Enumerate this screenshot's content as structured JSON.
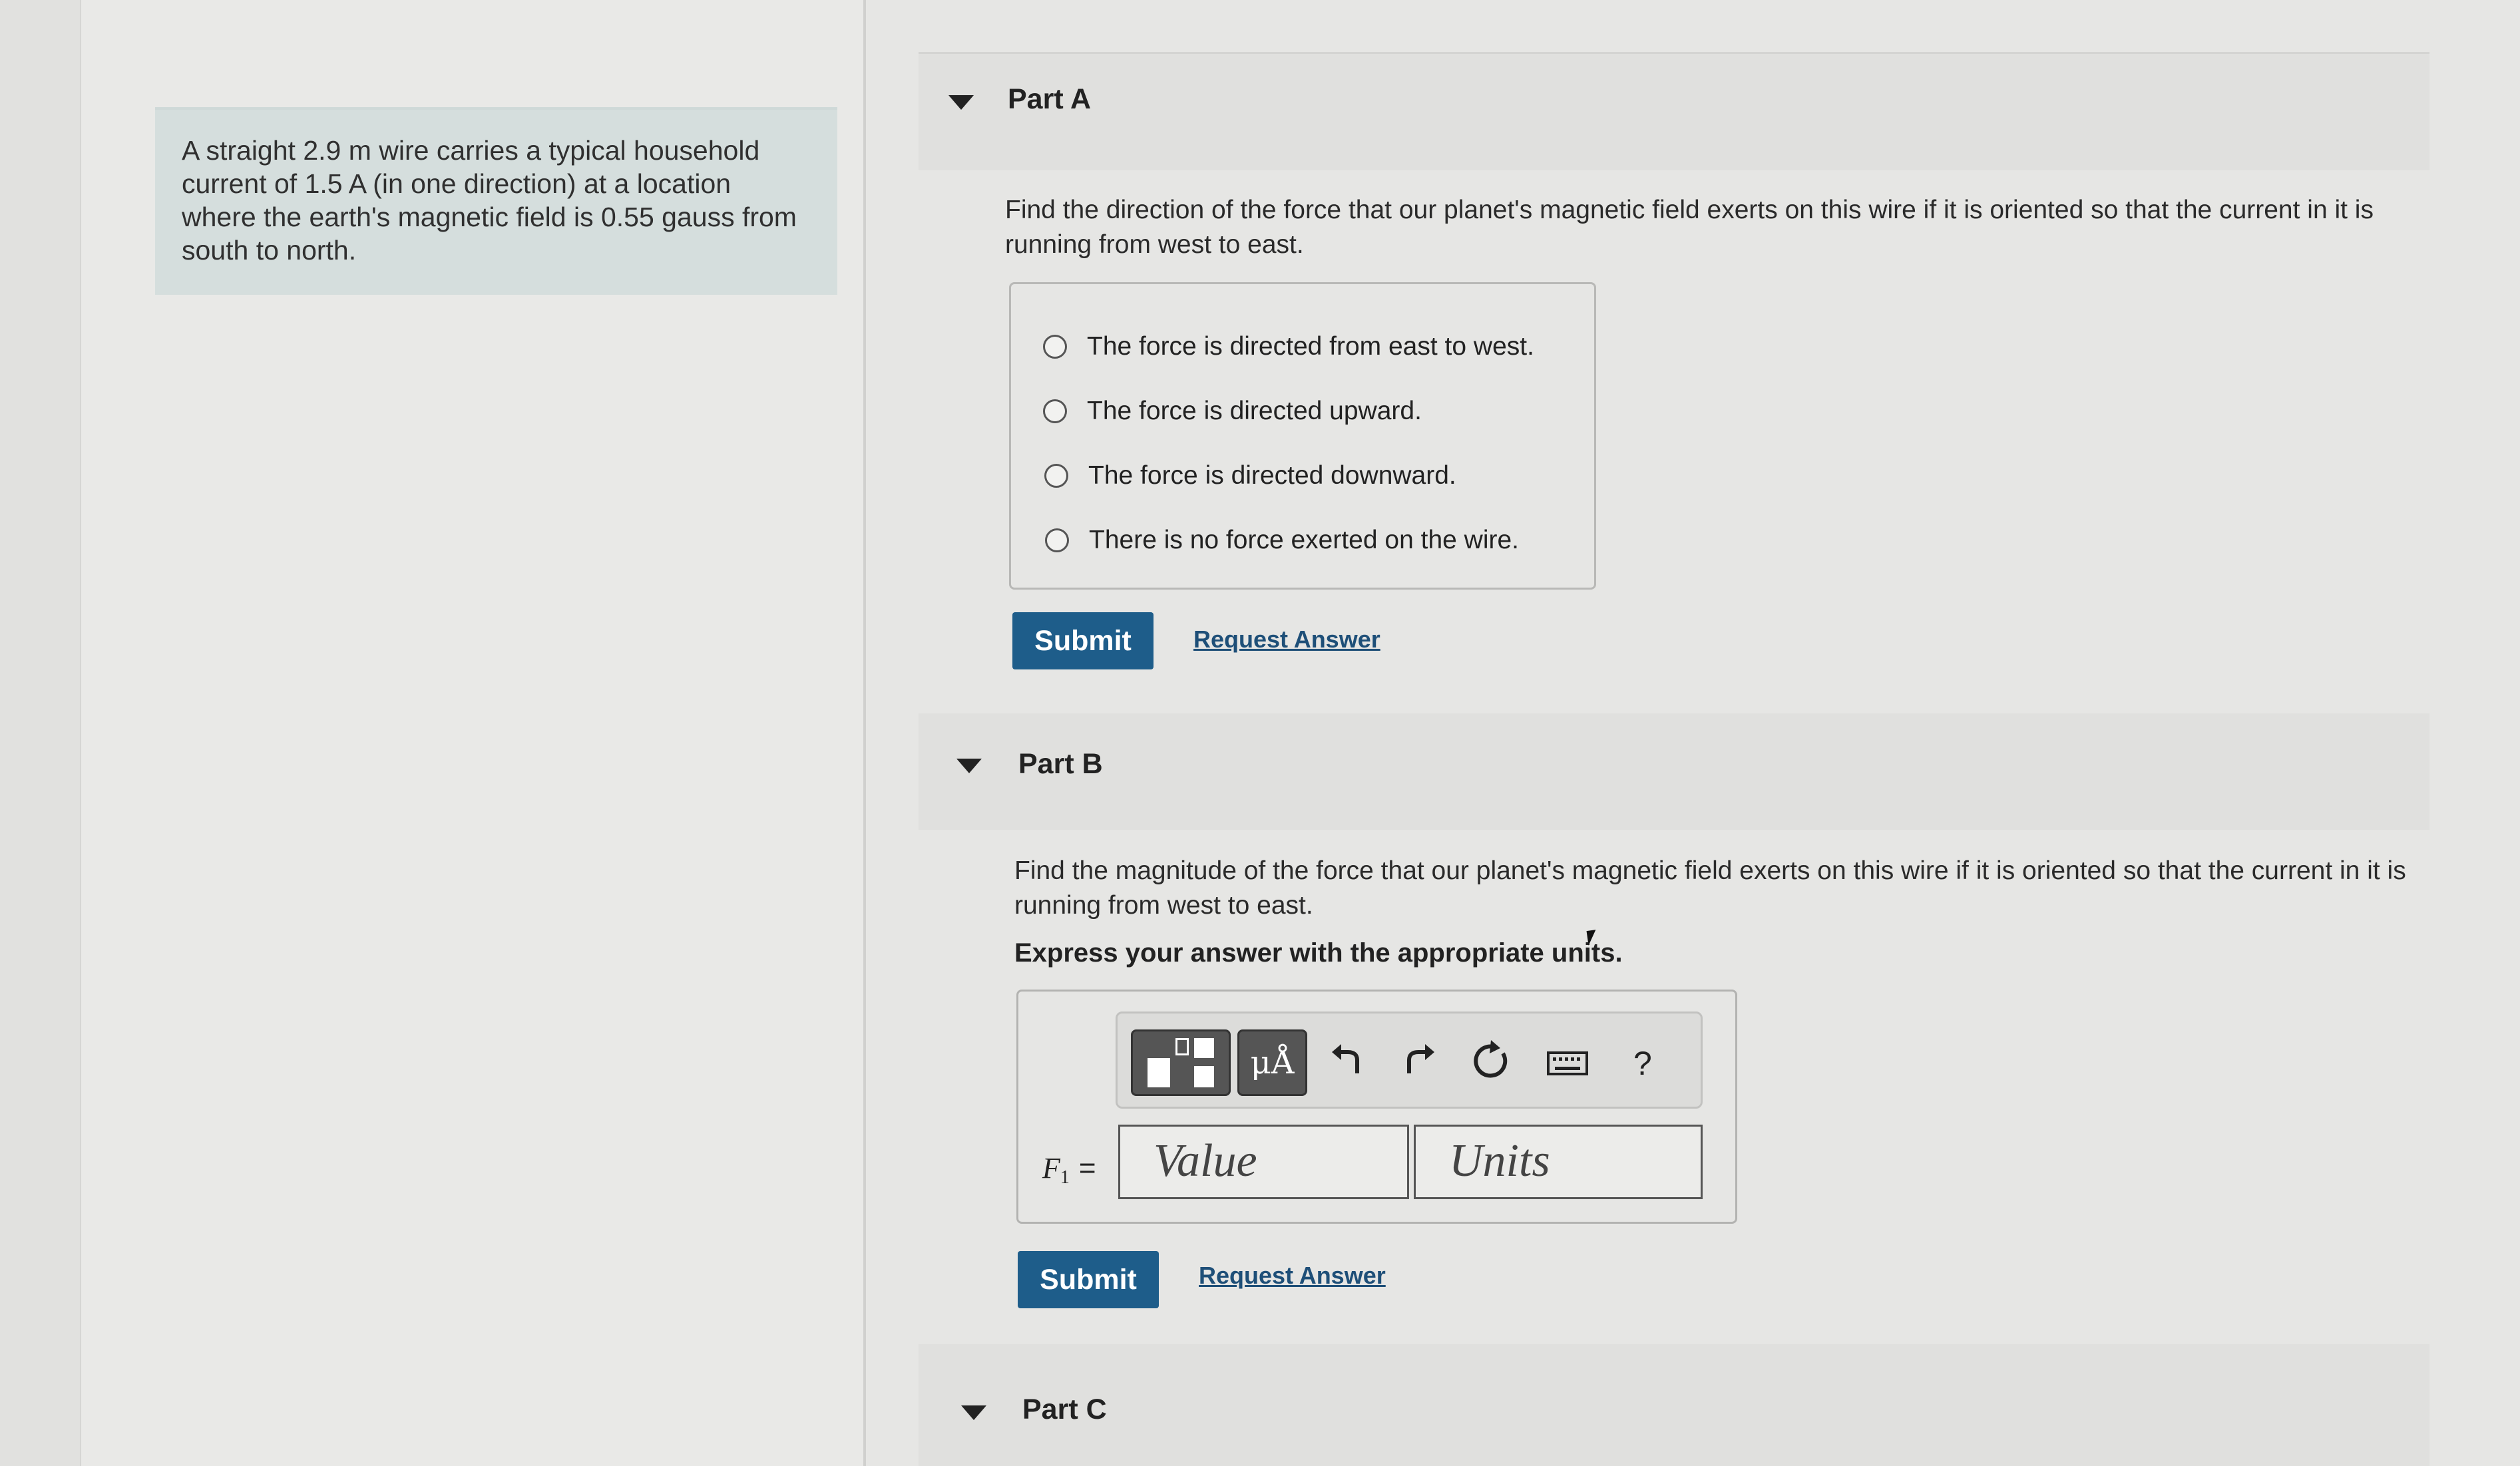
{
  "problem": {
    "text": "A straight 2.9 m wire carries a typical household current of 1.5 A (in one direction) at a location where the earth's magnetic field is 0.55 gauss from south to north."
  },
  "part_a": {
    "title": "Part A",
    "question": "Find the direction of the force that our planet's magnetic field exerts on this wire if it is oriented so that the current in it is running from west to east.",
    "choices": [
      "The force is directed from east to west.",
      "The force is directed upward.",
      "The force is directed downward.",
      "There is no force exerted on the wire."
    ],
    "submit_label": "Submit",
    "request_label": "Request Answer"
  },
  "part_b": {
    "title": "Part B",
    "question": "Find the magnitude of the force that our planet's magnetic field exerts on this wire if it is oriented so that the current in it is running from west to east.",
    "instruction": "Express your answer with the appropriate units.",
    "toolbar": {
      "units_label": "μÅ",
      "help_label": "?"
    },
    "variable": "F",
    "variable_sub": "1",
    "equals": "=",
    "value_placeholder": "Value",
    "units_placeholder": "Units",
    "submit_label": "Submit",
    "request_label": "Request Answer"
  },
  "part_c": {
    "title": "Part C"
  }
}
